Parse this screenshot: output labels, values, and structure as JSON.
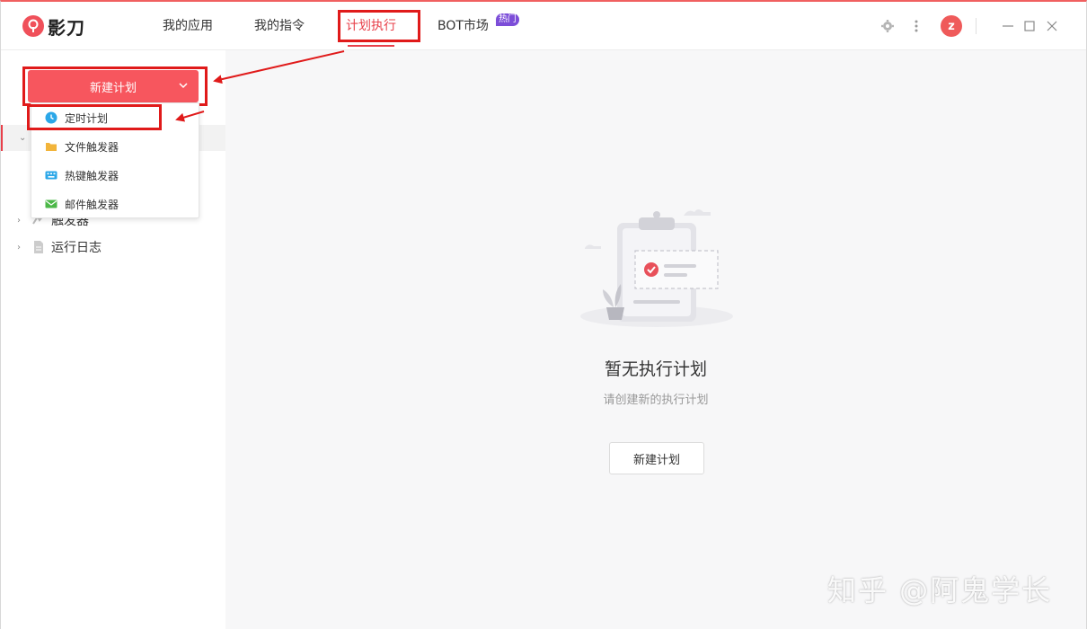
{
  "app": {
    "name": "影刀"
  },
  "nav": {
    "tabs": [
      {
        "label": "我的应用"
      },
      {
        "label": "我的指令"
      },
      {
        "label": "计划执行"
      },
      {
        "label": "BOT市场",
        "badge": "热门"
      }
    ]
  },
  "header": {
    "avatar_initial": "z"
  },
  "sidebar": {
    "new_plan_button": "新建计划",
    "tree": [
      {
        "label": "触发器"
      },
      {
        "label": "运行日志"
      }
    ]
  },
  "dropdown": {
    "items": [
      {
        "label": "定时计划",
        "icon": "clock-icon"
      },
      {
        "label": "文件触发器",
        "icon": "folder-icon"
      },
      {
        "label": "热键触发器",
        "icon": "keyboard-icon"
      },
      {
        "label": "邮件触发器",
        "icon": "mail-icon"
      }
    ]
  },
  "main": {
    "empty_title": "暂无执行计划",
    "empty_subtitle": "请创建新的执行计划",
    "empty_button": "新建计划"
  },
  "watermark": "知乎 @阿鬼学长",
  "colors": {
    "accent": "#e8404a",
    "button": "#f7565e",
    "badge": "#7c4dd8",
    "annotation": "#e01a1a"
  }
}
